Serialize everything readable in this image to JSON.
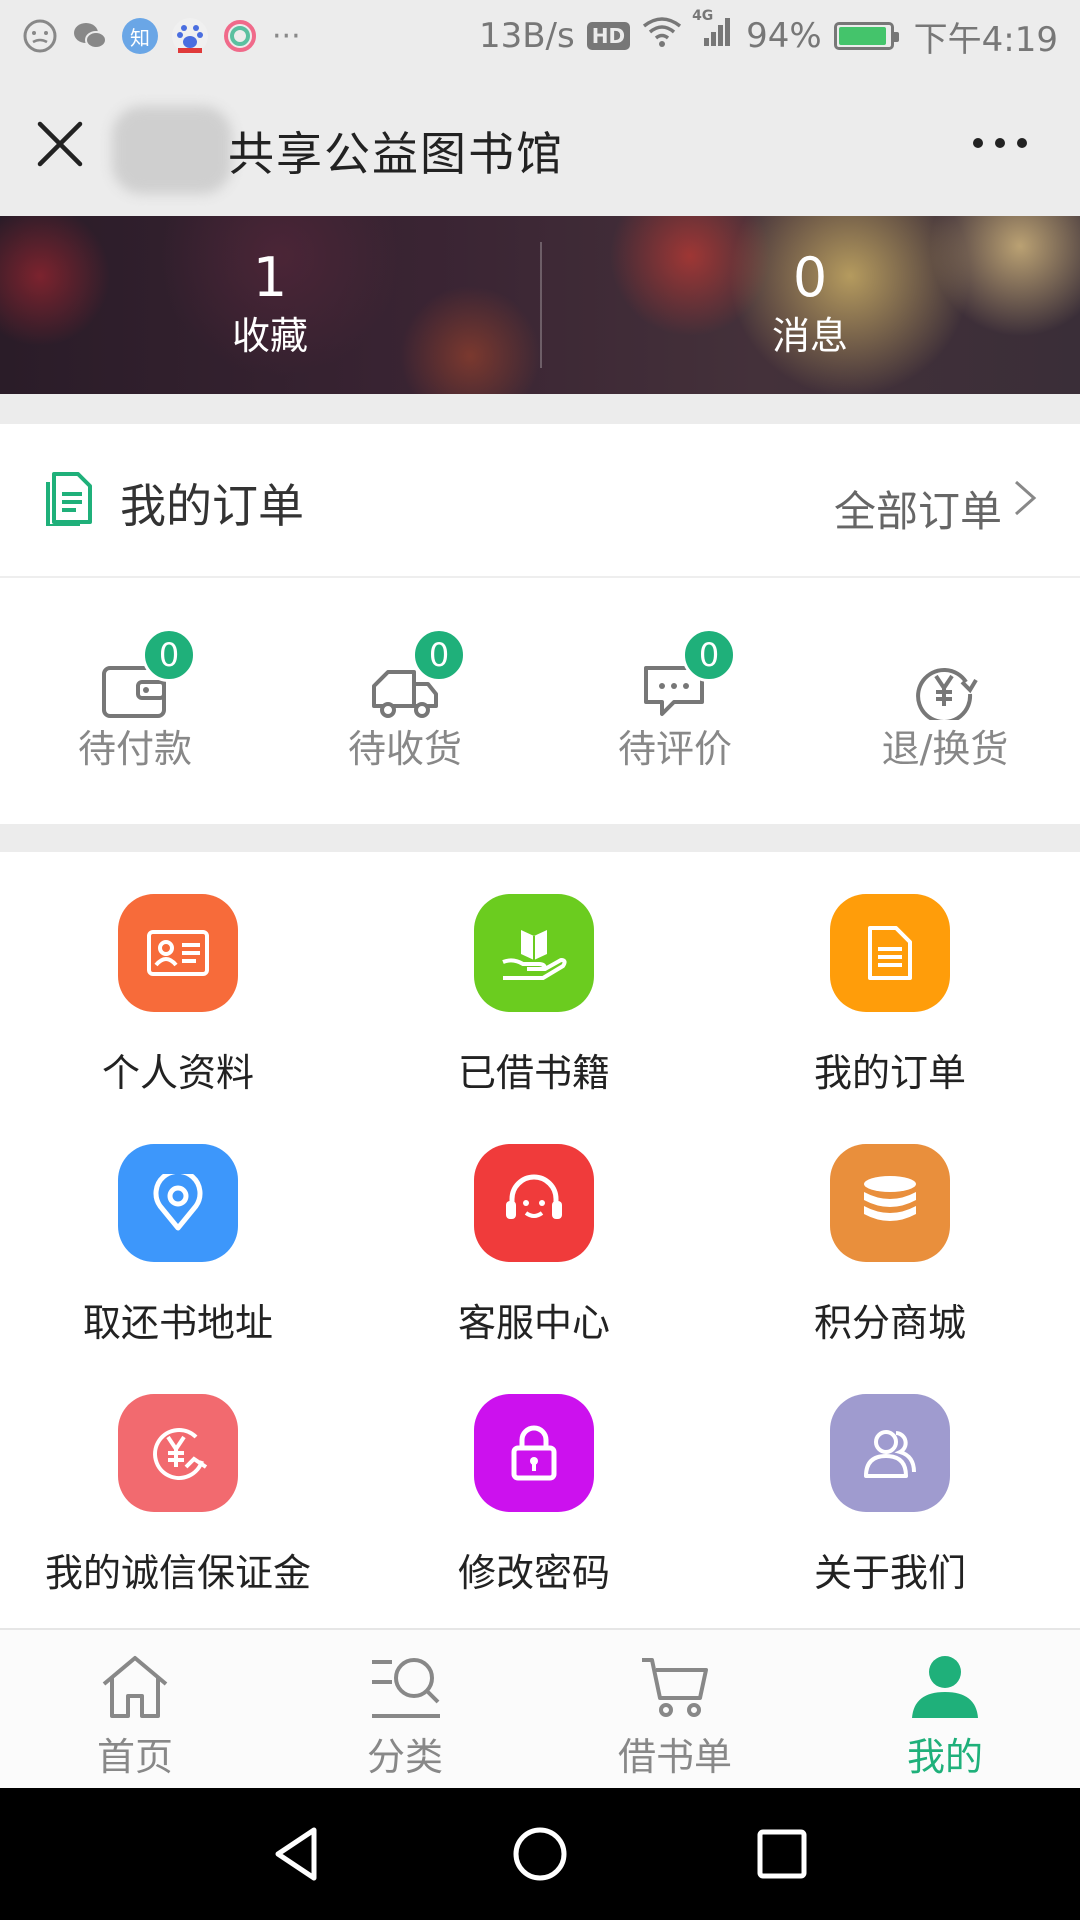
{
  "status_bar": {
    "net_speed": "13B/s",
    "hd": "HD",
    "network": "4G",
    "battery": "94%",
    "time": "下午4:19",
    "app_badge_zhihu": "知",
    "more": "···"
  },
  "title_bar": {
    "title": "共享公益图书馆"
  },
  "stats": [
    {
      "value": "1",
      "label": "收藏"
    },
    {
      "value": "0",
      "label": "消息"
    }
  ],
  "orders": {
    "title": "我的订单",
    "all_link": "全部订单",
    "statuses": [
      {
        "label": "待付款",
        "count": "0",
        "icon": "wallet-icon"
      },
      {
        "label": "待收货",
        "count": "0",
        "icon": "truck-icon"
      },
      {
        "label": "待评价",
        "count": "0",
        "icon": "comment-icon"
      },
      {
        "label": "退/换货",
        "icon": "yen-return-icon"
      }
    ]
  },
  "grid": [
    {
      "label": "个人资料",
      "icon": "profile-card-icon",
      "color": "#f76b3a"
    },
    {
      "label": "已借书籍",
      "icon": "book-hand-icon",
      "color": "#6bcc1f"
    },
    {
      "label": "我的订单",
      "icon": "document-icon",
      "color": "#ff9d0a"
    },
    {
      "label": "取还书地址",
      "icon": "location-icon",
      "color": "#3d97fb"
    },
    {
      "label": "客服中心",
      "icon": "headset-icon",
      "color": "#f03b3b"
    },
    {
      "label": "积分商城",
      "icon": "coins-icon",
      "color": "#e98f3c"
    },
    {
      "label": "我的诚信保证金",
      "icon": "yen-deposit-icon",
      "color": "#f26a6f"
    },
    {
      "label": "修改密码",
      "icon": "lock-icon",
      "color": "#cc11ee"
    },
    {
      "label": "关于我们",
      "icon": "users-icon",
      "color": "#9f9bcf"
    }
  ],
  "tabs": [
    {
      "label": "首页",
      "icon": "home-icon"
    },
    {
      "label": "分类",
      "icon": "category-search-icon"
    },
    {
      "label": "借书单",
      "icon": "cart-icon"
    },
    {
      "label": "我的",
      "icon": "user-icon",
      "active": true
    }
  ],
  "colors": {
    "accent": "#1fb07a",
    "text_muted": "#888888"
  }
}
